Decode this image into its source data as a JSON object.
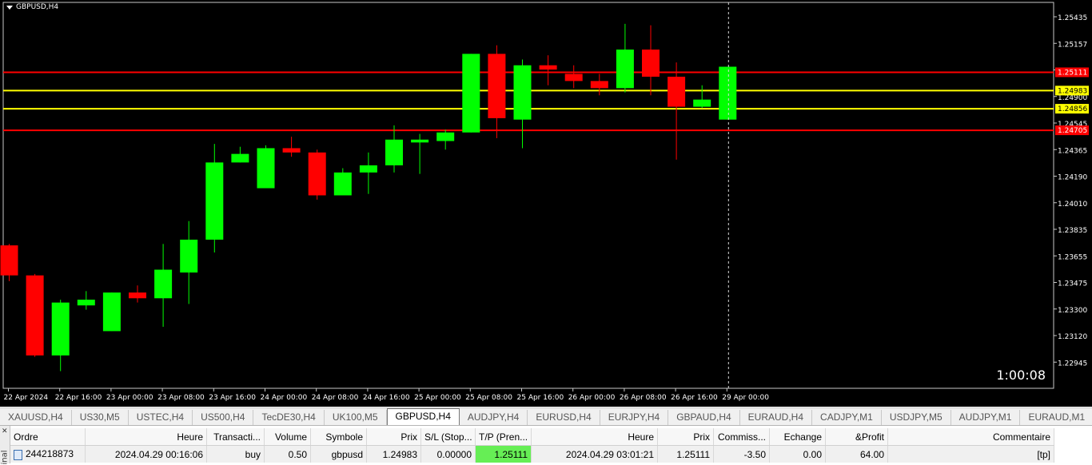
{
  "chart": {
    "title": "GBPUSD,H4",
    "timer": "1:00:08",
    "price_labels": [
      "1.25435",
      "1.25157",
      "1.25080",
      "1.24900",
      "1.24545",
      "1.24365",
      "1.24190",
      "1.24010",
      "1.23835",
      "1.23655",
      "1.23475",
      "1.23300",
      "1.23120",
      "1.22945"
    ],
    "level_tags": [
      {
        "text": "1.25111",
        "color": "#ff0000"
      },
      {
        "text": "1.24983",
        "color": "#ffff00"
      },
      {
        "text": "1.24856",
        "color": "#ffff00"
      },
      {
        "text": "1.24705",
        "color": "#ff0000"
      }
    ],
    "time_labels": [
      "22 Apr 2024",
      "22 Apr 16:00",
      "23 Apr 00:00",
      "23 Apr 08:00",
      "23 Apr 16:00",
      "24 Apr 00:00",
      "24 Apr 08:00",
      "24 Apr 16:00",
      "25 Apr 00:00",
      "25 Apr 08:00",
      "25 Apr 16:00",
      "26 Apr 00:00",
      "26 Apr 08:00",
      "26 Apr 16:00",
      "29 Apr 00:00"
    ],
    "colors": {
      "bull": "#00ff00",
      "bear": "#ff0000",
      "bg": "#000000",
      "resistance": "#ff0000",
      "support": "#ffff00"
    }
  },
  "chart_data": {
    "type": "candlestick",
    "symbol": "GBPUSD",
    "timeframe": "H4",
    "horizontal_lines": [
      1.25111,
      1.24983,
      1.24856,
      1.24705
    ],
    "ylim": [
      1.229,
      1.256
    ],
    "candles": [
      {
        "o": 1.239,
        "h": 1.2391,
        "l": 1.2365,
        "c": 1.2369
      },
      {
        "o": 1.2369,
        "h": 1.237,
        "l": 1.2312,
        "c": 1.2313
      },
      {
        "o": 1.2313,
        "h": 1.2352,
        "l": 1.2302,
        "c": 1.235
      },
      {
        "o": 1.2348,
        "h": 1.2358,
        "l": 1.2345,
        "c": 1.2352
      },
      {
        "o": 1.233,
        "h": 1.2357,
        "l": 1.233,
        "c": 1.2357
      },
      {
        "o": 1.2357,
        "h": 1.2362,
        "l": 1.235,
        "c": 1.2353
      },
      {
        "o": 1.2353,
        "h": 1.2391,
        "l": 1.2333,
        "c": 1.2373
      },
      {
        "o": 1.2371,
        "h": 1.2407,
        "l": 1.2349,
        "c": 1.2394
      },
      {
        "o": 1.2394,
        "h": 1.2461,
        "l": 1.2385,
        "c": 1.2448
      },
      {
        "o": 1.2448,
        "h": 1.2459,
        "l": 1.2448,
        "c": 1.2454
      },
      {
        "o": 1.243,
        "h": 1.246,
        "l": 1.243,
        "c": 1.2458
      },
      {
        "o": 1.2458,
        "h": 1.2466,
        "l": 1.2452,
        "c": 1.2455
      },
      {
        "o": 1.2455,
        "h": 1.2457,
        "l": 1.2422,
        "c": 1.2425
      },
      {
        "o": 1.2425,
        "h": 1.2444,
        "l": 1.2425,
        "c": 1.2441
      },
      {
        "o": 1.2441,
        "h": 1.2455,
        "l": 1.2426,
        "c": 1.2446
      },
      {
        "o": 1.2446,
        "h": 1.2474,
        "l": 1.2441,
        "c": 1.2464
      },
      {
        "o": 1.2462,
        "h": 1.2468,
        "l": 1.244,
        "c": 1.2464
      },
      {
        "o": 1.2463,
        "h": 1.2471,
        "l": 1.2457,
        "c": 1.2469
      },
      {
        "o": 1.2469,
        "h": 1.2524,
        "l": 1.2469,
        "c": 1.2524
      },
      {
        "o": 1.2524,
        "h": 1.253,
        "l": 1.2465,
        "c": 1.2479
      },
      {
        "o": 1.2478,
        "h": 1.252,
        "l": 1.2458,
        "c": 1.2516
      },
      {
        "o": 1.2516,
        "h": 1.2523,
        "l": 1.2502,
        "c": 1.2513
      },
      {
        "o": 1.251,
        "h": 1.2516,
        "l": 1.25,
        "c": 1.2505
      },
      {
        "o": 1.2505,
        "h": 1.251,
        "l": 1.2495,
        "c": 1.25
      },
      {
        "o": 1.25,
        "h": 1.2545,
        "l": 1.2497,
        "c": 1.2527
      },
      {
        "o": 1.2527,
        "h": 1.2544,
        "l": 1.2495,
        "c": 1.2508
      },
      {
        "o": 1.2508,
        "h": 1.2518,
        "l": 1.245,
        "c": 1.2487
      },
      {
        "o": 1.2487,
        "h": 1.2502,
        "l": 1.2486,
        "c": 1.2492
      },
      {
        "o": 1.2478,
        "h": 1.2515,
        "l": 1.2478,
        "c": 1.2515
      }
    ]
  },
  "tabs": [
    {
      "label": "XAUUSD,H4",
      "active": false
    },
    {
      "label": "US30,M5",
      "active": false
    },
    {
      "label": "USTEC,H4",
      "active": false
    },
    {
      "label": "US500,H4",
      "active": false
    },
    {
      "label": "TecDE30,H4",
      "active": false
    },
    {
      "label": "UK100,M5",
      "active": false
    },
    {
      "label": "GBPUSD,H4",
      "active": true
    },
    {
      "label": "AUDJPY,H4",
      "active": false
    },
    {
      "label": "EURUSD,H4",
      "active": false
    },
    {
      "label": "EURJPY,H4",
      "active": false
    },
    {
      "label": "GBPAUD,H4",
      "active": false
    },
    {
      "label": "EURAUD,H4",
      "active": false
    },
    {
      "label": "CADJPY,M1",
      "active": false
    },
    {
      "label": "USDJPY,M5",
      "active": false
    },
    {
      "label": "AUDJPY,M1",
      "active": false
    },
    {
      "label": "EURAUD,M1",
      "active": false
    },
    {
      "label": "G",
      "active": false
    }
  ],
  "terminal": {
    "side_label": "inal",
    "columns": [
      "Ordre",
      "Heure",
      "Transacti...",
      "Volume",
      "Symbole",
      "Prix",
      "S/L (Stop...",
      "T/P (Pren...",
      "Heure",
      "Prix",
      "Commiss...",
      "Echange",
      "&Profit",
      "Commentaire"
    ],
    "rows": [
      [
        "244218873",
        "2024.04.29 00:16:06",
        "buy",
        "0.50",
        "gbpusd",
        "1.24983",
        "0.00000",
        "1.25111",
        "2024.04.29 03:01:21",
        "1.25111",
        "-3.50",
        "0.00",
        "64.00",
        "[tp]"
      ]
    ]
  }
}
